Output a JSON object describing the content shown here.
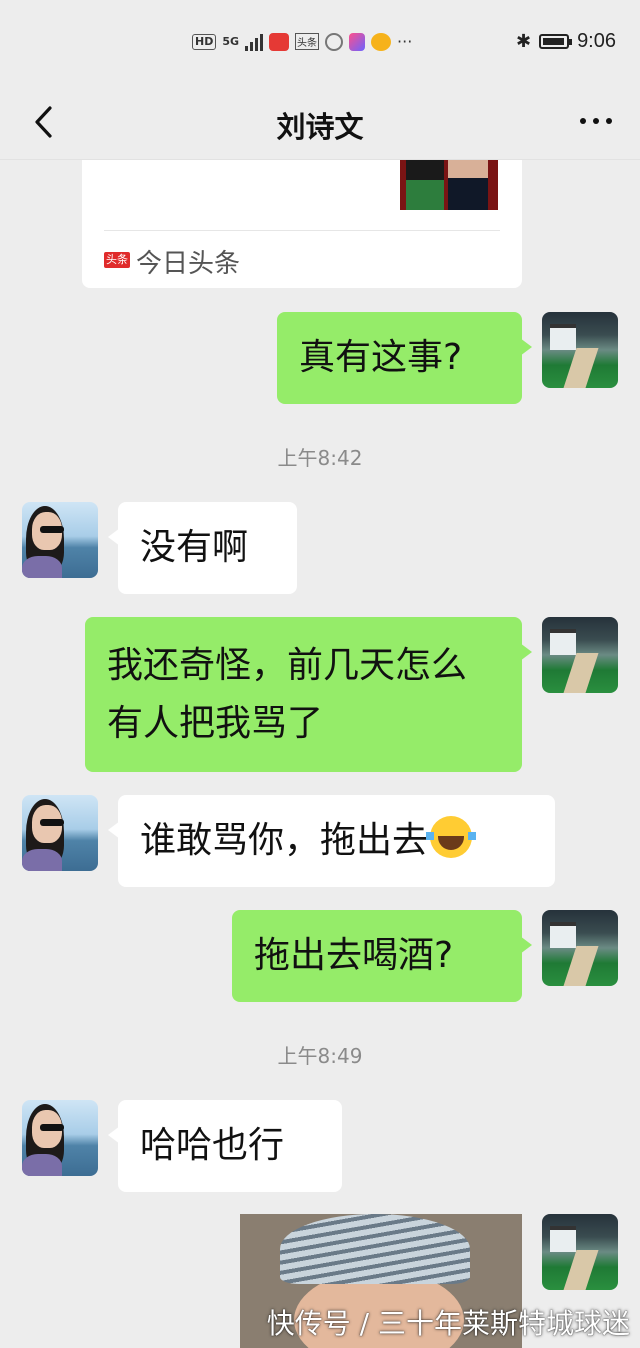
{
  "status_bar": {
    "hd": "HD",
    "network": "5G",
    "toutiao_icon": "头条",
    "more": "···",
    "time": "9:06"
  },
  "header": {
    "title": "刘诗文"
  },
  "shared_card": {
    "source": "今日头条",
    "badge": "头条"
  },
  "messages": [
    {
      "from": "me",
      "text": "真有这事?"
    },
    {
      "type": "time",
      "text": "上午8:42"
    },
    {
      "from": "her",
      "text": "没有啊"
    },
    {
      "from": "me",
      "text": "我还奇怪，前几天怎么有人把我骂了"
    },
    {
      "from": "her",
      "text": "谁敢骂你，拖出去",
      "emoji": "laughing-crying-emoji"
    },
    {
      "from": "me",
      "text": "拖出去喝酒?"
    },
    {
      "type": "time",
      "text": "上午8:49"
    },
    {
      "from": "her",
      "text": "哈哈也行"
    }
  ],
  "watermark": "快传号 / 三十年莱斯特城球迷",
  "colors": {
    "background": "#ededed",
    "my_bubble": "#95ec69",
    "her_bubble": "#ffffff"
  }
}
